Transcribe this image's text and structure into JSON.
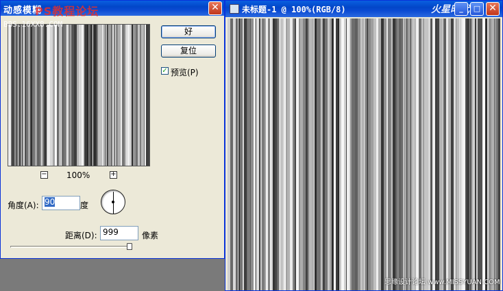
{
  "dialog": {
    "title": "动感模糊",
    "watermark_top": "PS教程论坛",
    "watermark_url": "BBS.16XX8.COM",
    "zoom_out": "−",
    "zoom_in": "+",
    "zoom_level": "100%",
    "ok_label": "好",
    "reset_label": "复位",
    "preview_label": "预览(P)",
    "preview_checked": true,
    "angle_label": "角度(A):",
    "angle_value": "90",
    "angle_unit": "度",
    "distance_label": "距离(D):",
    "distance_value": "999",
    "distance_unit": "像素",
    "close_glyph": "✕"
  },
  "document": {
    "title": "未标题-1 @ 100%(RGB/8)",
    "logo": "火星时代",
    "minimize_glyph": "_",
    "maximize_glyph": "□",
    "close_glyph": "✕",
    "watermark_bottom": "思缘设计论坛 www.MISSYUAN.COM"
  },
  "colors": {
    "titlebar": "#0a4ad2",
    "dialog_bg": "#ece9d8",
    "workspace": "#7a7a7a"
  }
}
